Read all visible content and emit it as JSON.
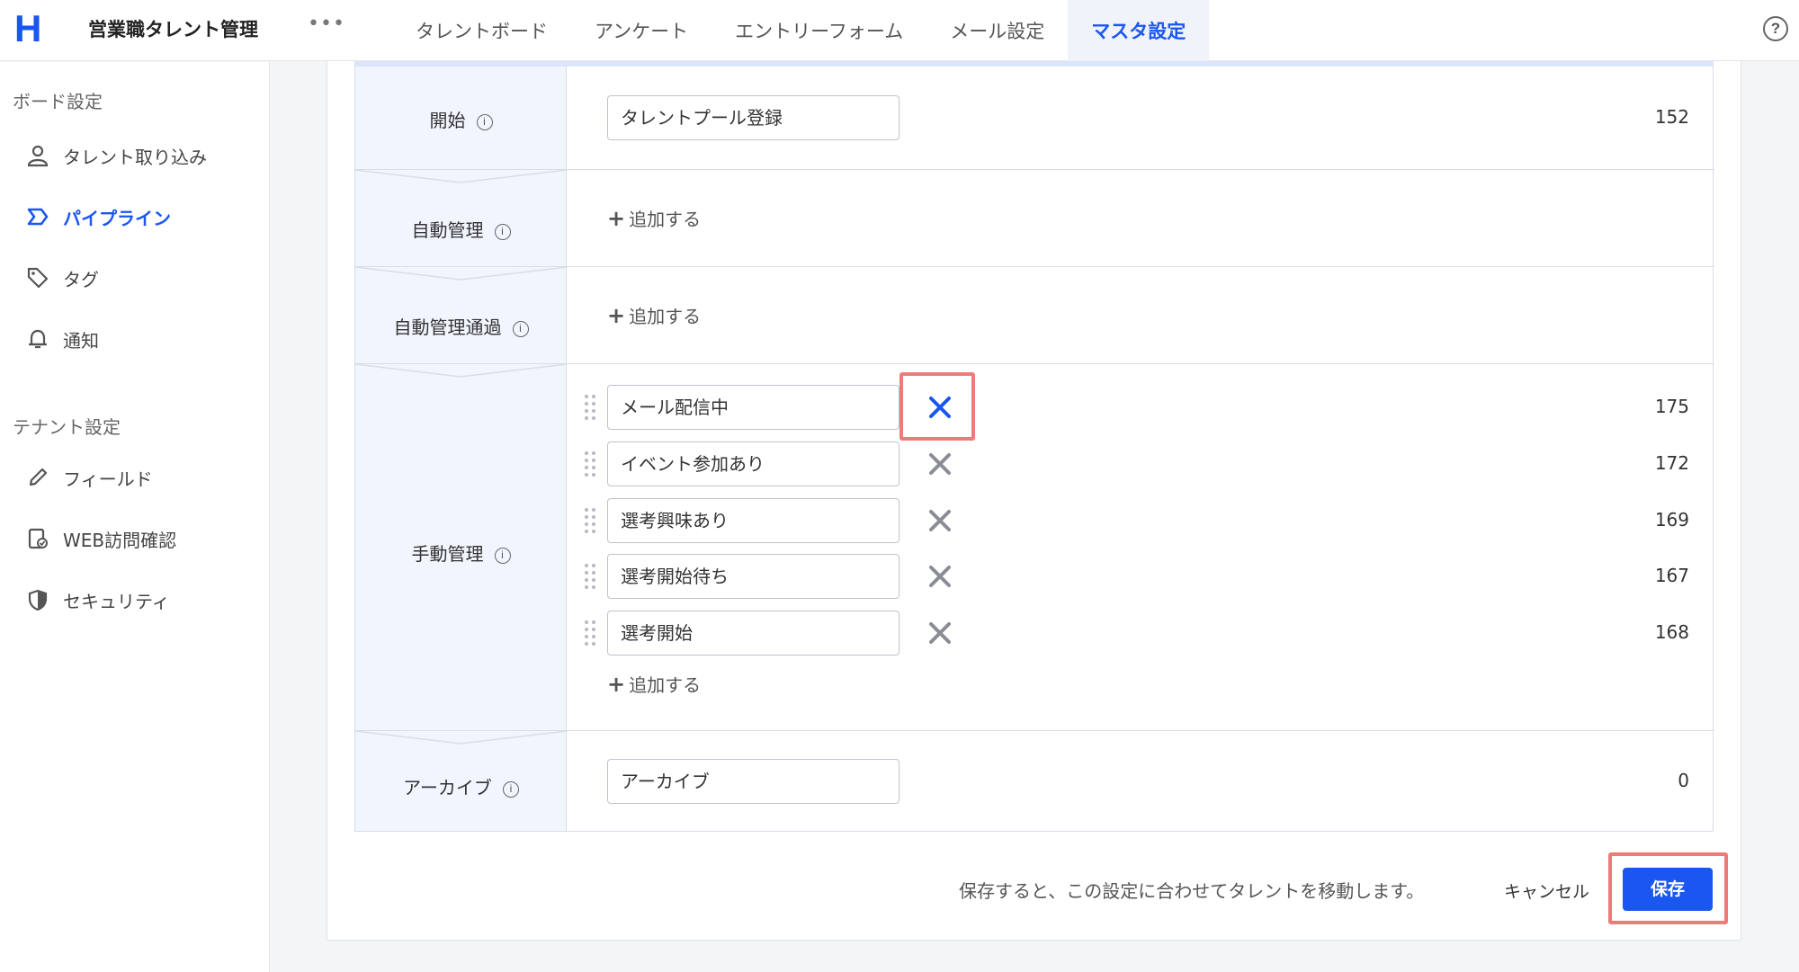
{
  "header": {
    "logo": "H",
    "app_title": "営業職タレント管理",
    "more": "•••",
    "tabs": [
      {
        "label": "タレントボード"
      },
      {
        "label": "アンケート"
      },
      {
        "label": "エントリーフォーム"
      },
      {
        "label": "メール設定"
      },
      {
        "label": "マスタ設定",
        "active": true
      }
    ],
    "help": "?"
  },
  "sidebar": {
    "board_section": "ボード設定",
    "board_items": [
      {
        "label": "タレント取り込み",
        "icon": "person-icon"
      },
      {
        "label": "パイプライン",
        "icon": "pipeline-icon",
        "active": true
      },
      {
        "label": "タグ",
        "icon": "tag-icon"
      },
      {
        "label": "通知",
        "icon": "bell-icon"
      }
    ],
    "tenant_section": "テナント設定",
    "tenant_items": [
      {
        "label": "フィールド",
        "icon": "pencil-icon"
      },
      {
        "label": "WEB訪問確認",
        "icon": "web-check-icon"
      },
      {
        "label": "セキュリティ",
        "icon": "shield-icon"
      }
    ]
  },
  "pipeline": {
    "info_glyph": "i",
    "add_label": "追加する",
    "start": {
      "label": "開始",
      "value": "タレントプール登録",
      "count": "152"
    },
    "auto": {
      "label": "自動管理"
    },
    "auto_pass": {
      "label": "自動管理通過"
    },
    "manual": {
      "label": "手動管理",
      "items": [
        {
          "value": "メール配信中",
          "count": "175"
        },
        {
          "value": "イベント参加あり",
          "count": "172"
        },
        {
          "value": "選考興味あり",
          "count": "169"
        },
        {
          "value": "選考開始待ち",
          "count": "167"
        },
        {
          "value": "選考開始",
          "count": "168"
        }
      ]
    },
    "archive": {
      "label": "アーカイブ",
      "value": "アーカイブ",
      "count": "0"
    }
  },
  "footer": {
    "note": "保存すると、この設定に合わせてタレントを移動します。",
    "cancel_label": "キャンセル",
    "save_label": "保存"
  },
  "colors": {
    "accent": "#1a56f0",
    "highlight": "#ee7a7a",
    "label_bg": "#f1f5fd"
  }
}
